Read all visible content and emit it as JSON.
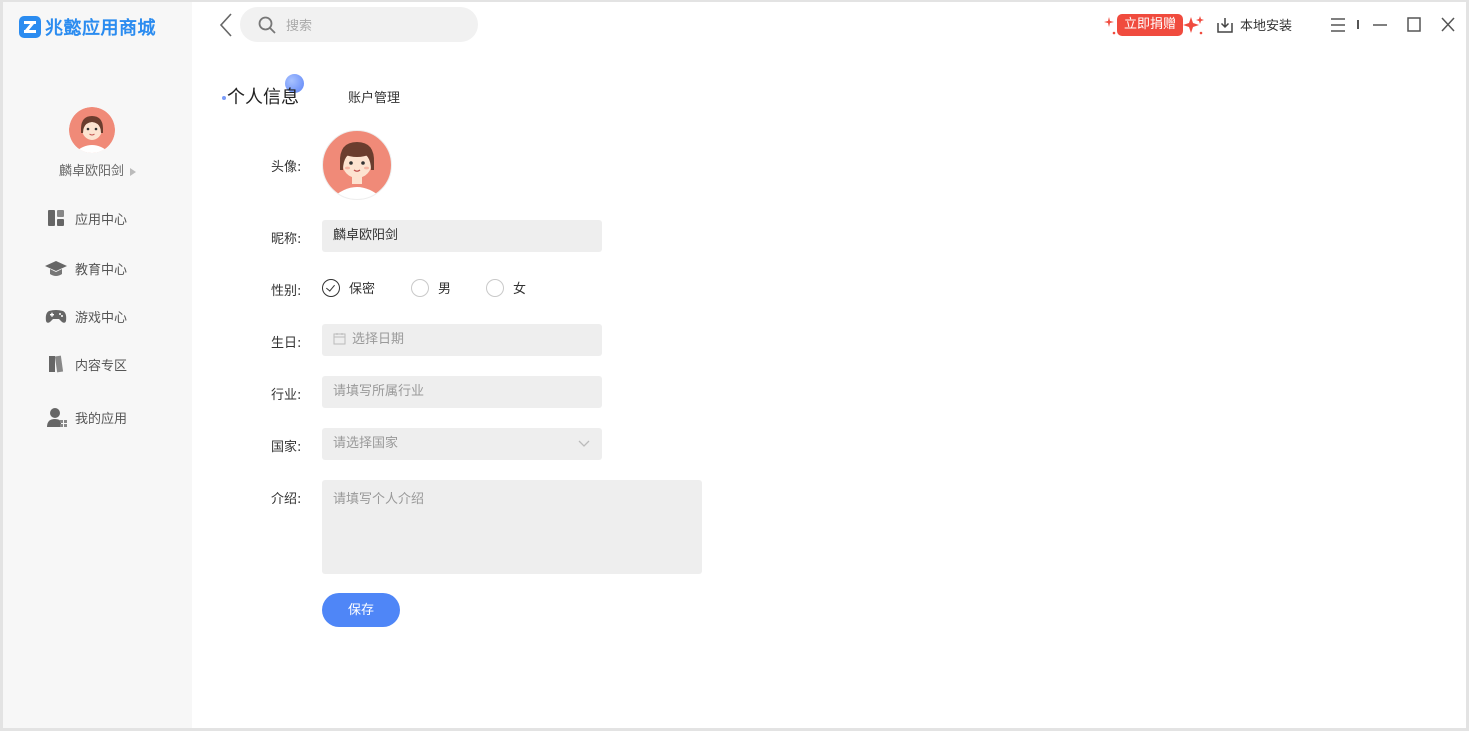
{
  "app": {
    "name": "兆懿应用商城"
  },
  "user": {
    "name": "麟卓欧阳剑"
  },
  "sidebar": {
    "items": [
      {
        "label": "应用中心",
        "icon": "app-center-icon"
      },
      {
        "label": "教育中心",
        "icon": "graduation-cap-icon"
      },
      {
        "label": "游戏中心",
        "icon": "gamepad-icon"
      },
      {
        "label": "内容专区",
        "icon": "books-icon"
      },
      {
        "label": "我的应用",
        "icon": "my-apps-icon"
      }
    ]
  },
  "topbar": {
    "search_placeholder": "搜索",
    "donate_label": "立即捐赠",
    "local_install_label": "本地安装"
  },
  "tabs": {
    "active": "个人信息",
    "other": "账户管理"
  },
  "form": {
    "avatar_label": "头像:",
    "nickname_label": "昵称:",
    "nickname_value": "麟卓欧阳剑",
    "gender_label": "性别:",
    "gender_options": [
      "保密",
      "男",
      "女"
    ],
    "gender_selected": "保密",
    "birthday_label": "生日:",
    "birthday_placeholder": "选择日期",
    "industry_label": "行业:",
    "industry_placeholder": "请填写所属行业",
    "country_label": "国家:",
    "country_placeholder": "请选择国家",
    "intro_label": "介绍:",
    "intro_placeholder": "请填写个人介绍",
    "save_label": "保存"
  },
  "colors": {
    "brand": "#2b8cf0",
    "primary_button": "#4f86f7",
    "donate": "#f04b3e",
    "avatar_bg": "#f08a78"
  }
}
